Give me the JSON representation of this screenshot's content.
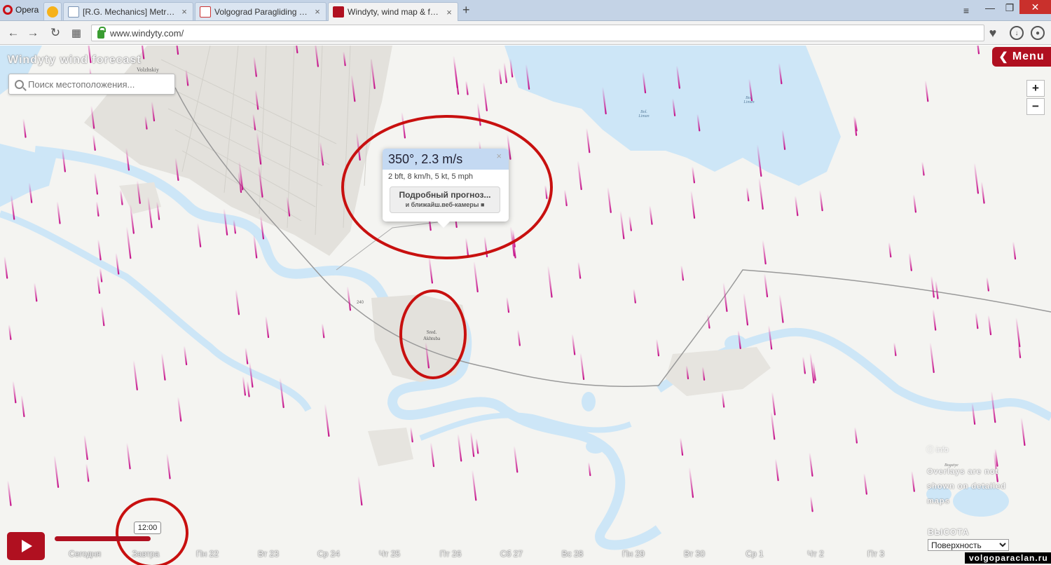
{
  "browser": {
    "menu_label": "Opera",
    "tabs": [
      {
        "title": "",
        "active": false
      },
      {
        "title": "[R.G. Mechanics] Metro Re",
        "active": false
      },
      {
        "title": "Volgograd Paragliding - M",
        "active": false
      },
      {
        "title": "Windyty, wind map & fore",
        "active": true
      }
    ],
    "new_tab": "+",
    "url": "www.windyty.com/"
  },
  "app": {
    "brand": "Windyty wind forecast",
    "search_placeholder": "Поиск местоположения...",
    "menu_label": "Menu",
    "zoom_in": "+",
    "zoom_out": "−",
    "brand_color": "#b01020"
  },
  "map_labels": {
    "city": "Volzhskiy",
    "lake1": "Bol. Liman",
    "lake2": "Bol. Liman",
    "town_line1": "Sred.",
    "town_line2": "Akhtuba",
    "place": "Bogatye",
    "road": "240"
  },
  "popup": {
    "title": "350°, 2.3 m/s",
    "subtitle": "2 bft, 8 km/h, 5 kt, 5 mph",
    "button_line1": "Подробный прогноз...",
    "button_line2": "и ближайш.веб-камеры"
  },
  "overlay_note": {
    "info": "ⓘ info",
    "text": "Overlays are not shown on detailed maps"
  },
  "height": {
    "label": "ВЫСОТА",
    "selected": "Поверхность"
  },
  "timeline": {
    "time": "12:00",
    "days": [
      "Сегодня",
      "Завтра",
      "Пн 22",
      "Вт 23",
      "Ср 24",
      "Чт 25",
      "Пт 26",
      "Сб 27",
      "Вс 28",
      "Пн 29",
      "Вт 30",
      "Ср 1",
      "Чт 2",
      "Пт 3"
    ],
    "progress_fraction": 0.1
  },
  "watermark": "volgoparaclan.ru"
}
